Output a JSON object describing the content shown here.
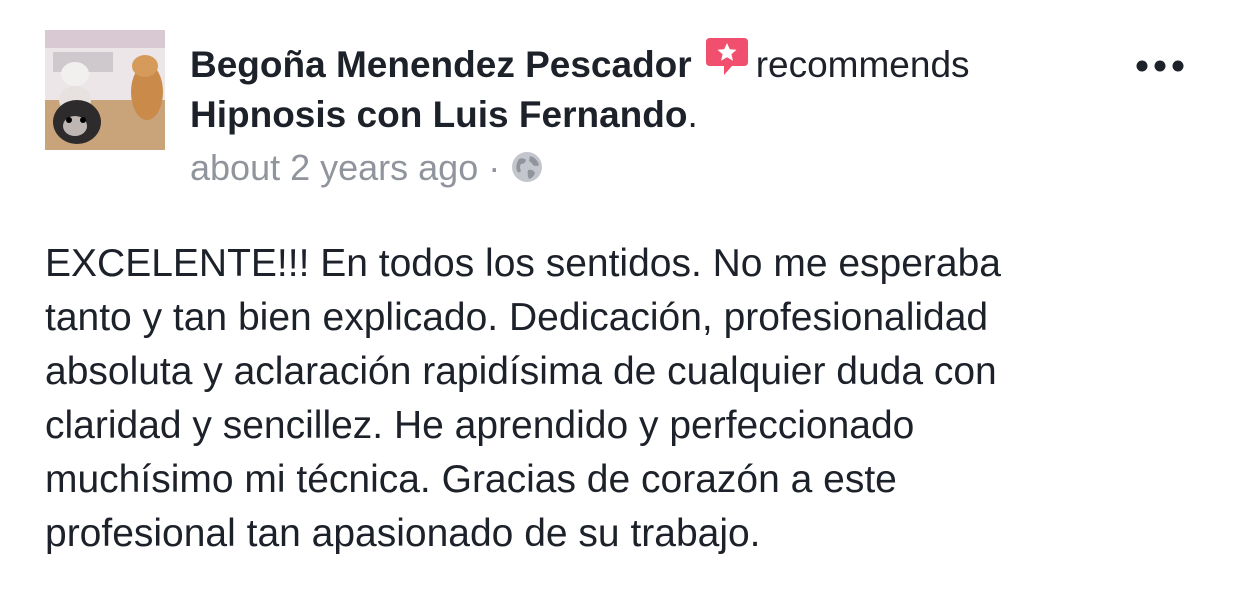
{
  "post": {
    "author": "Begoña Menendez Pescador",
    "recommend_icon": "recommend-star-bubble-icon",
    "action": "recommends",
    "page_name": "Hipnosis con Luis Fernando",
    "page_suffix": ".",
    "time": "about 2 years ago",
    "separator": "·",
    "privacy_icon": "globe-icon",
    "more_icon": "more-options-icon",
    "review_lines": [
      "EXCELENTE!!! En todos los sentidos. No me esperaba",
      "tanto y tan bien explicado. Dedicación, profesionalidad",
      "absoluta y aclaración rapidísima de cualquier duda con",
      "claridad y sencillez. He aprendido y perfeccionado",
      "muchísimo mi técnica. Gracias de corazón a este",
      "profesional tan apasionado de su trabajo."
    ]
  },
  "colors": {
    "text": "#1d2129",
    "meta": "#90949c",
    "recommend_accent": "#f0506e"
  }
}
